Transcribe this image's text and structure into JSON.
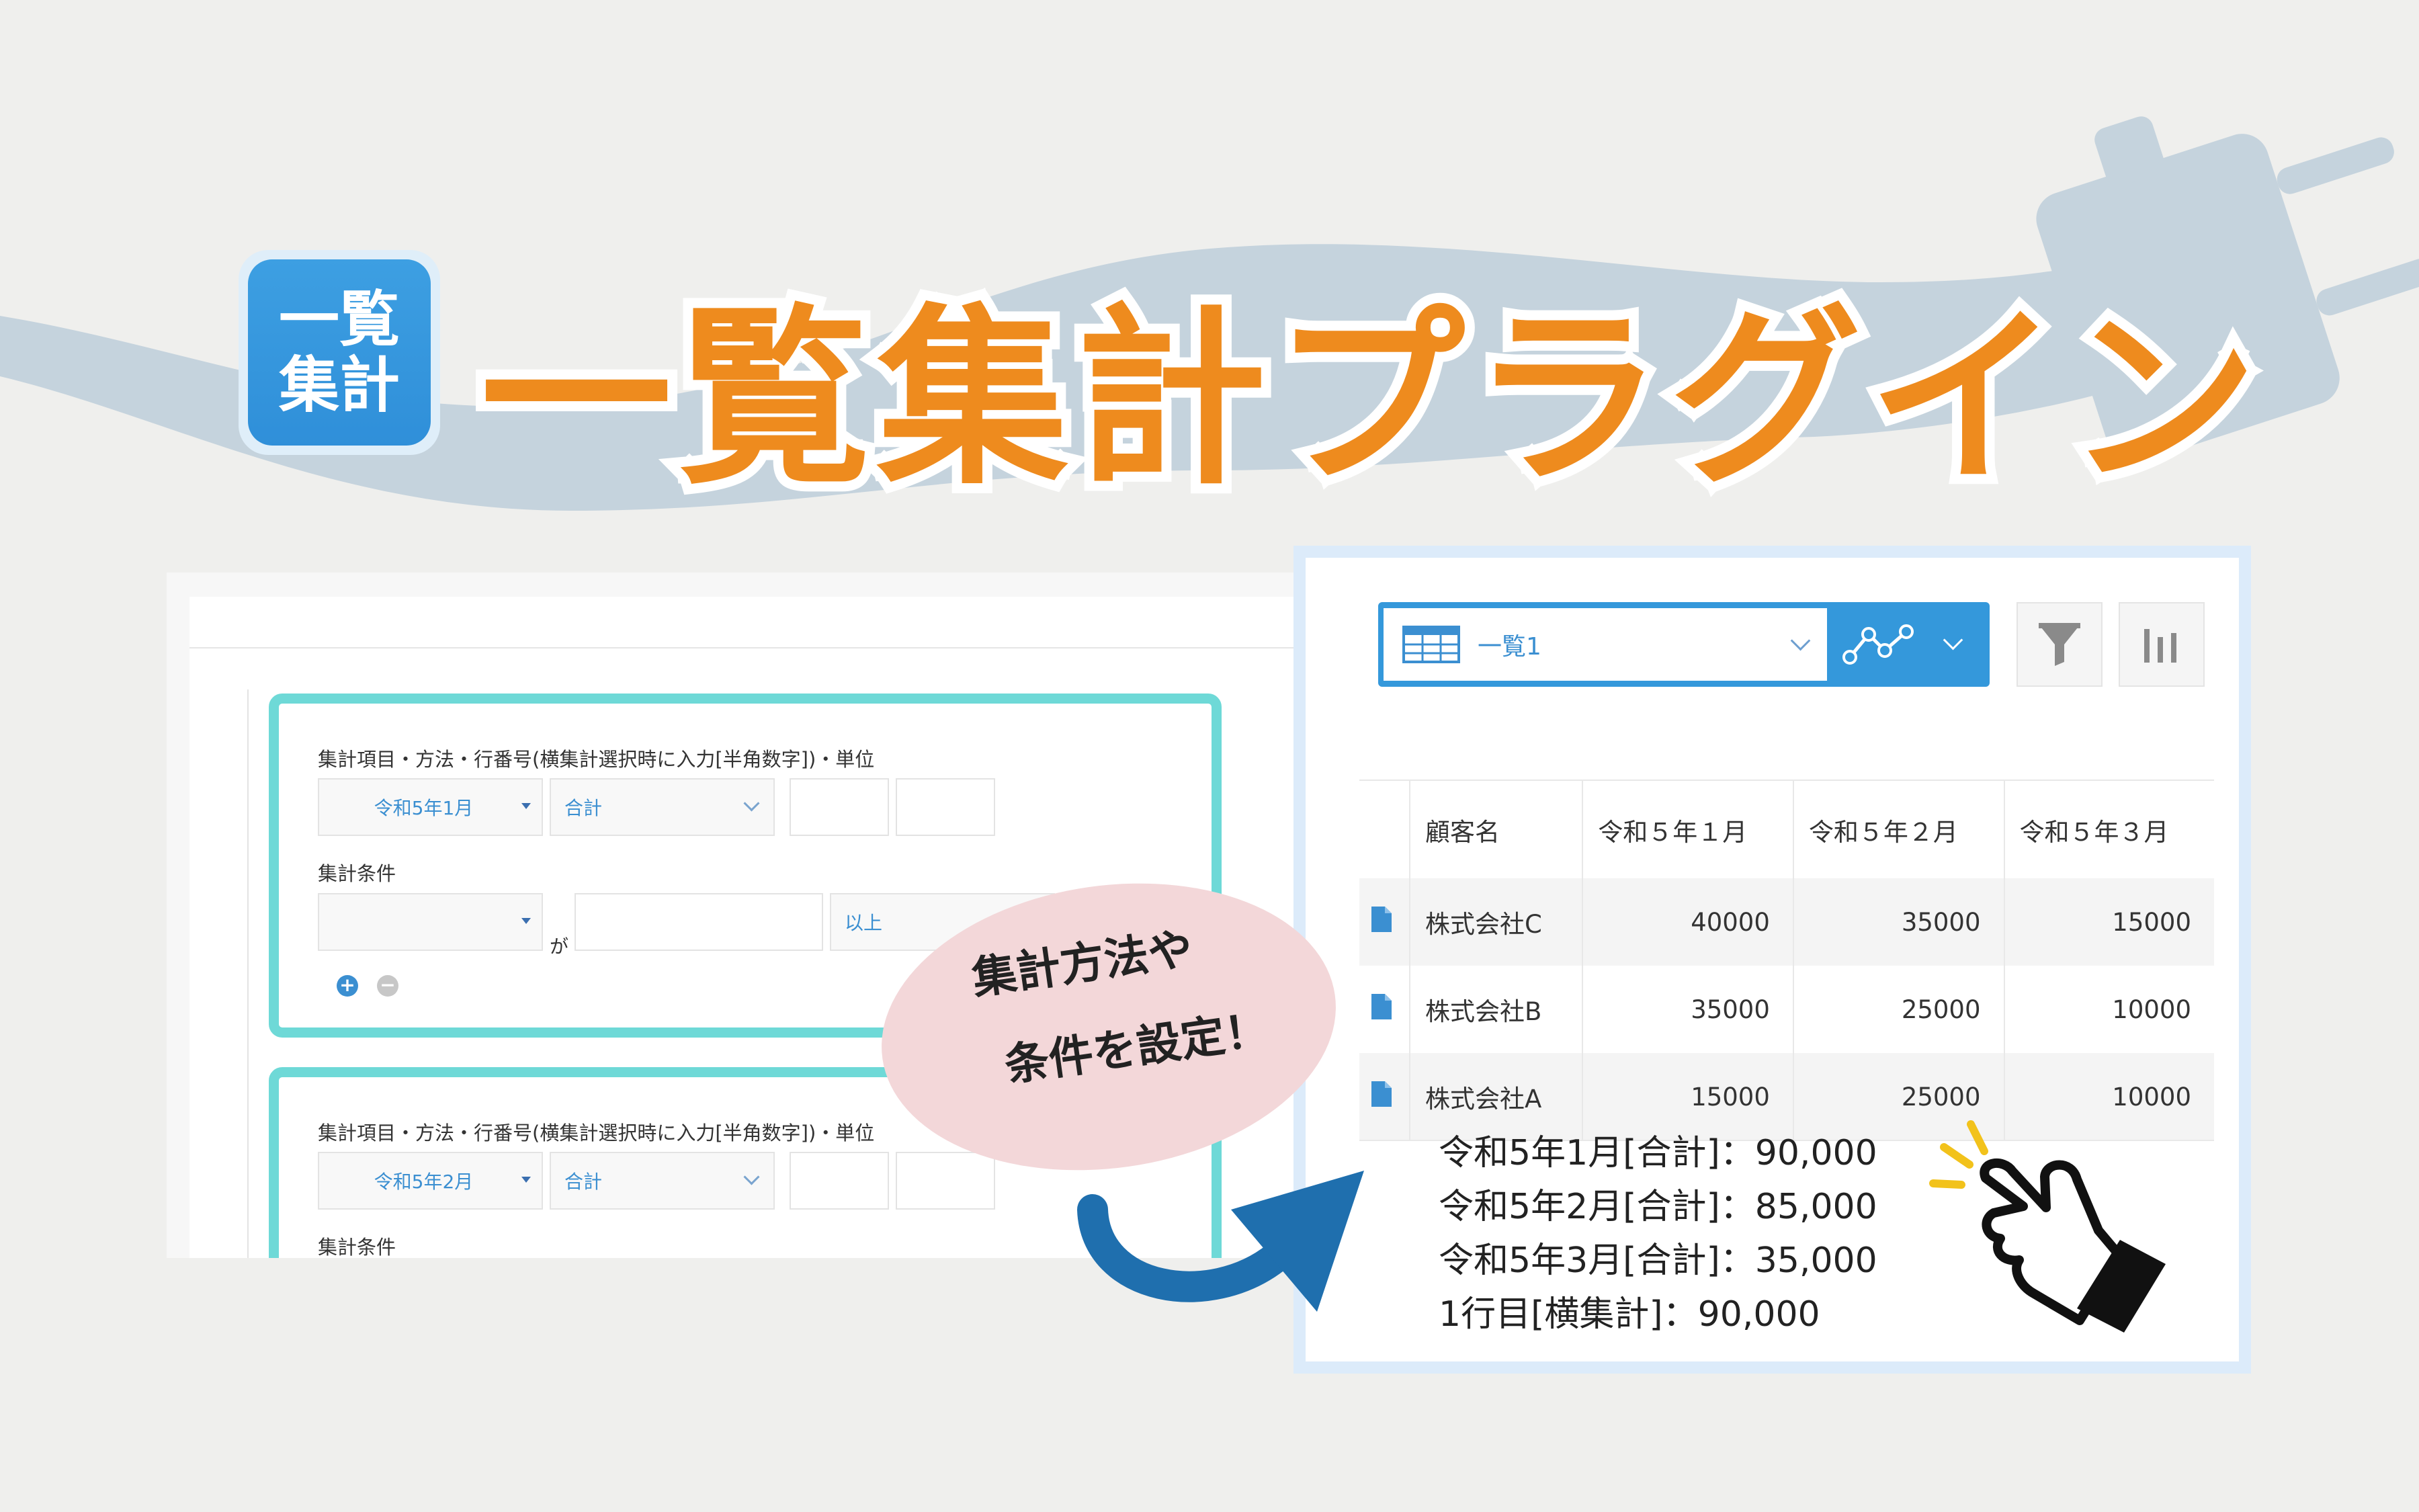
{
  "header": {
    "logo_line1": "一覧",
    "logo_line2": "集計",
    "title": "一覧集計プラグイン"
  },
  "settings": {
    "cards": [
      {
        "item_label": "集計項目・方法・行番号(横集計選択時に入力[半角数字])・単位",
        "field_value": "令和5年1月",
        "method_value": "合計",
        "condition_label": "集計条件",
        "condition_field": "",
        "ga": "が",
        "operator": "以上"
      },
      {
        "item_label": "集計項目・方法・行番号(横集計選択時に入力[半角数字])・単位",
        "field_value": "令和5年2月",
        "method_value": "合計",
        "condition_label": "集計条件"
      }
    ],
    "add_icon": "plus-circle-icon",
    "remove_icon": "minus-circle-icon"
  },
  "list_view": {
    "view_name": "一覧1",
    "headers": [
      "顧客名",
      "令和５年１月",
      "令和５年２月",
      "令和５年３月"
    ],
    "rows": [
      [
        "株式会社C",
        "40000",
        "35000",
        "15000"
      ],
      [
        "株式会社B",
        "35000",
        "25000",
        "10000"
      ],
      [
        "株式会社A",
        "15000",
        "25000",
        "10000"
      ]
    ],
    "totals": [
      "令和5年1月[合計]：90,000",
      "令和5年2月[合計]：85,000",
      "令和5年3月[合計]：35,000",
      "1行目[横集計]：90,000"
    ]
  },
  "callout": {
    "line1": "集計方法や",
    "line2": "条件を設定！"
  },
  "colors": {
    "title_orange": "#ee8b1e",
    "logo_blue": "#3498db",
    "card_teal": "#6ed9d7",
    "callout_pink": "#f3d7d9",
    "arrow_blue": "#1f6fae"
  }
}
